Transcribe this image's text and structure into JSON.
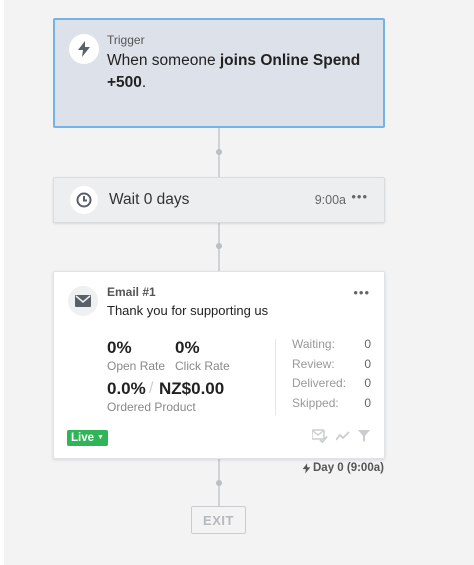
{
  "trigger": {
    "label": "Trigger",
    "text_prefix": "When someone ",
    "text_bold": "joins Online Spend +500",
    "text_suffix": ".",
    "icon": "lightning-icon"
  },
  "wait": {
    "label": "Wait 0 days",
    "time": "9:00a",
    "more": "•••",
    "icon": "clock-icon"
  },
  "email": {
    "title": "Email #1",
    "subject": "Thank you for supporting us",
    "more": "•••",
    "icon": "envelope-icon",
    "open_rate_value": "0%",
    "open_rate_label": "Open Rate",
    "click_rate_value": "0%",
    "click_rate_label": "Click Rate",
    "ordered_pct": "0.0%",
    "ordered_sep": "/",
    "ordered_amount": "NZ$0.00",
    "ordered_label": "Ordered Product",
    "status_rows": [
      {
        "label": "Waiting:",
        "value": "0"
      },
      {
        "label": "Review:",
        "value": "0"
      },
      {
        "label": "Delivered:",
        "value": "0"
      },
      {
        "label": "Skipped:",
        "value": "0"
      }
    ],
    "live_label": "Live",
    "action_icons": [
      "check-email-icon",
      "trend-icon",
      "filter-icon"
    ]
  },
  "day_label": "Day 0 (9:00a)",
  "exit_label": "EXIT",
  "colors": {
    "selected_border": "#75b2e8",
    "trigger_bg": "#dde2ea",
    "live_green": "#2fb457",
    "canvas_bg": "#f3f3f3"
  }
}
